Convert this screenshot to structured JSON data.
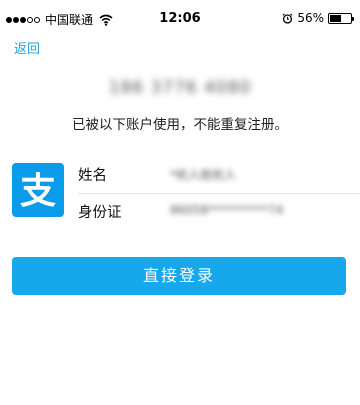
{
  "status_bar": {
    "carrier": "中国联通",
    "time": "12:06",
    "battery_percent": "56%",
    "battery_level": 0.56,
    "signal_bars_filled": 3,
    "signal_bars_total": 5
  },
  "nav": {
    "back_label": "返回"
  },
  "account": {
    "phone_masked": "186 3776 4080",
    "message": "已被以下账户使用，不能重复注册。",
    "name_label": "姓名",
    "name_value": "*杭人姓杭人",
    "id_label": "身份证",
    "id_value": "86058**********74"
  },
  "app_logo": {
    "icon": "alipay-logo-icon",
    "glyph": "支",
    "color": "#0a9bea"
  },
  "actions": {
    "login_label": "直接登录",
    "login_color": "#16a8ea"
  }
}
